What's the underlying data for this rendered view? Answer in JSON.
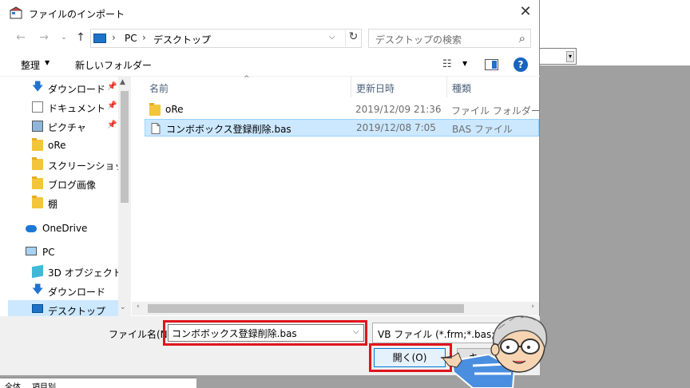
{
  "dialog": {
    "title": "ファイルのインポート",
    "close_label": "✕"
  },
  "nav": {
    "back": "←",
    "forward": "→",
    "up": "↑",
    "breadcrumb": [
      "PC",
      "デスクトップ"
    ],
    "search_placeholder": "デスクトップの検索"
  },
  "toolbar": {
    "organize": "整理",
    "new_folder": "新しいフォルダー",
    "help": "?"
  },
  "sidebar": {
    "items": [
      {
        "label": "ダウンロード",
        "icon": "download-icon",
        "pinned": true
      },
      {
        "label": "ドキュメント",
        "icon": "document-icon",
        "pinned": true
      },
      {
        "label": "ピクチャ",
        "icon": "pictures-icon",
        "pinned": true
      },
      {
        "label": "oRe",
        "icon": "folder-icon",
        "pinned": false
      },
      {
        "label": "スクリーンショット",
        "icon": "folder-icon",
        "pinned": false
      },
      {
        "label": "ブログ画像",
        "icon": "folder-icon",
        "pinned": false
      },
      {
        "label": "棚",
        "icon": "folder-icon",
        "pinned": false
      },
      {
        "label": "OneDrive",
        "icon": "onedrive-icon",
        "pinned": false
      },
      {
        "label": "PC",
        "icon": "pc-icon",
        "pinned": false
      },
      {
        "label": "3D オブジェクト",
        "icon": "3d-objects-icon",
        "pinned": false
      },
      {
        "label": "ダウンロード",
        "icon": "download-icon",
        "pinned": false
      },
      {
        "label": "デスクトップ",
        "icon": "desktop-icon",
        "pinned": false
      }
    ]
  },
  "filelist": {
    "columns": [
      "名前",
      "更新日時",
      "種類"
    ],
    "rows": [
      {
        "name": "oRe",
        "date": "2019/12/09 21:36",
        "type": "ファイル フォルダー",
        "icon": "folder-icon",
        "selected": false
      },
      {
        "name": "コンボボックス登録削除.bas",
        "date": "2019/12/08 7:05",
        "type": "BAS ファイル",
        "icon": "file-icon",
        "selected": true
      }
    ]
  },
  "bottom": {
    "filename_label": "ファイル名(N):",
    "filename_value": "コンボボックス登録削除.bas",
    "filetype_value": "VB ファイル (*.frm;*.bas;*.cl",
    "open_label": "開く(O)",
    "cancel_label": "キャンセル"
  },
  "background": {
    "tab1": "全体",
    "tab2": "項目別"
  },
  "colors": {
    "highlight_red": "#e0151d",
    "selection": "#cce8ff",
    "accent": "#0078d7"
  }
}
